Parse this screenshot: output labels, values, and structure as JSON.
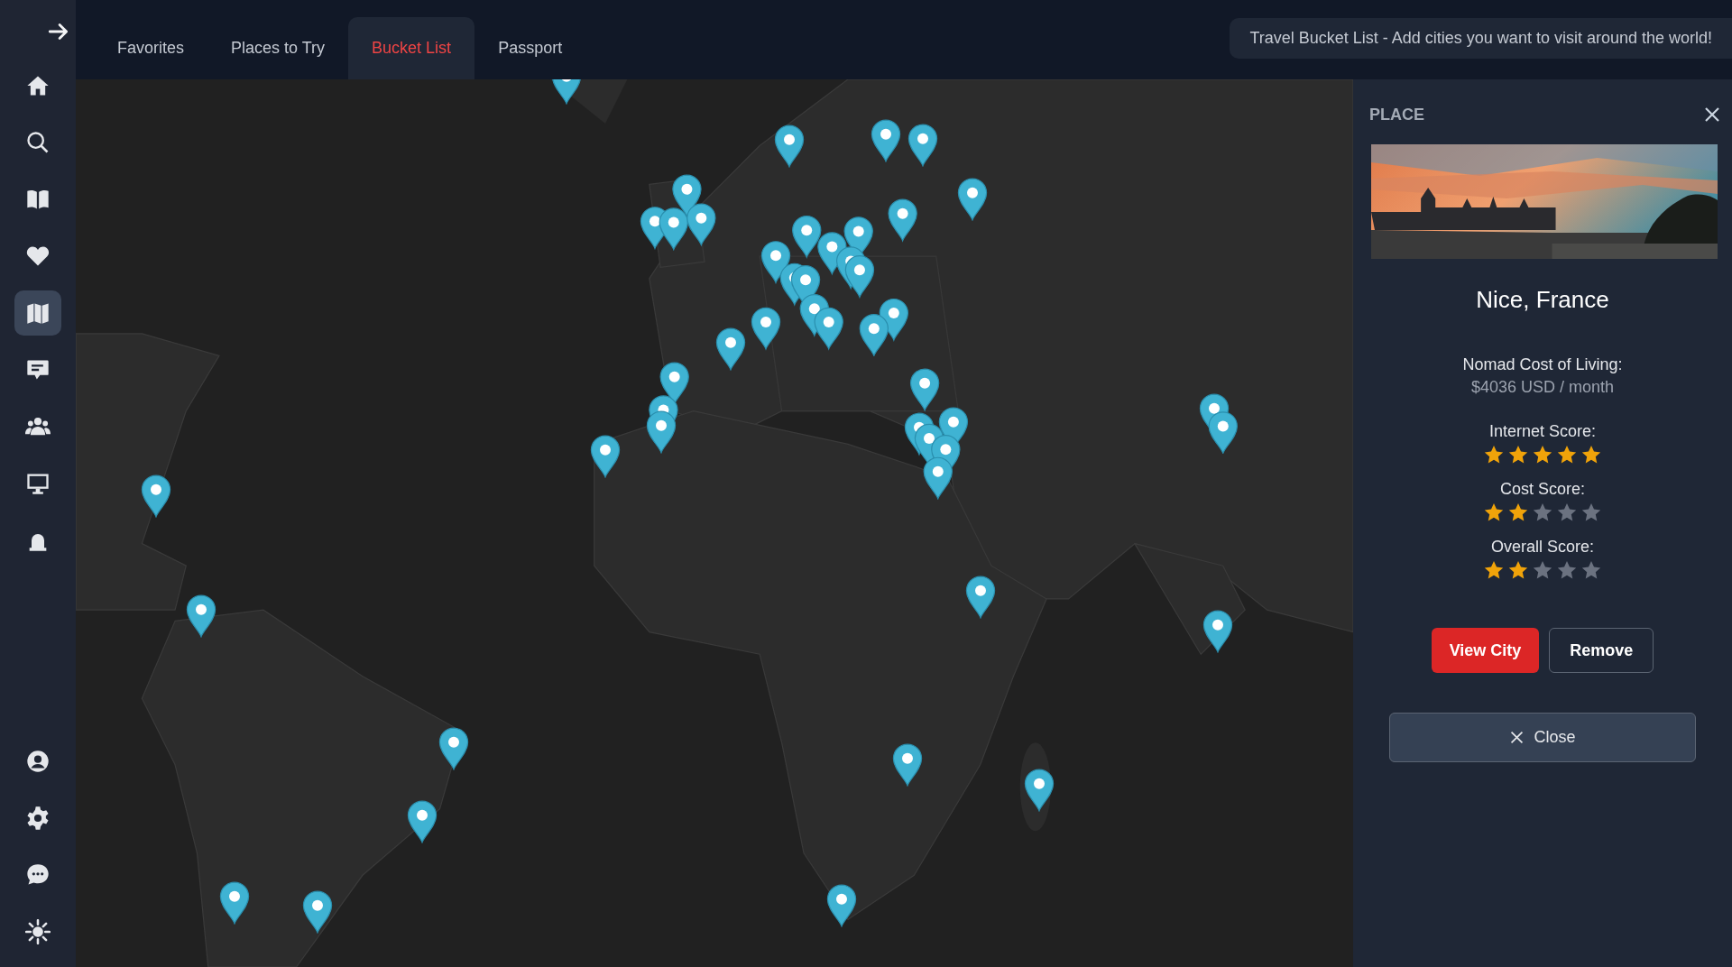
{
  "sidebar": {
    "items": [
      {
        "kind": "home",
        "selected": false
      },
      {
        "kind": "search",
        "selected": false
      },
      {
        "kind": "book",
        "selected": false
      },
      {
        "kind": "heart",
        "selected": false
      },
      {
        "kind": "map",
        "selected": true
      },
      {
        "kind": "message",
        "selected": false
      },
      {
        "kind": "group",
        "selected": false
      },
      {
        "kind": "monitor",
        "selected": false
      },
      {
        "kind": "stamp",
        "selected": false
      }
    ],
    "bottom_items": [
      {
        "kind": "user",
        "selected": false
      },
      {
        "kind": "gear",
        "selected": false
      },
      {
        "kind": "chat",
        "selected": false
      },
      {
        "kind": "sun",
        "selected": false
      }
    ]
  },
  "tabs": [
    {
      "label": "Favorites",
      "selected": false
    },
    {
      "label": "Places to Try",
      "selected": false
    },
    {
      "label": "Bucket List",
      "selected": true
    },
    {
      "label": "Passport",
      "selected": false
    }
  ],
  "banner": "Travel Bucket List - Add cities you want to visit around the world!",
  "place_panel": {
    "heading": "PLACE",
    "title": "Nice, France",
    "cost_label": "Nomad Cost of Living:",
    "cost_value": "$4036 USD / month",
    "scores": [
      {
        "label": "Internet Score:",
        "stars": 5
      },
      {
        "label": "Cost Score:",
        "stars": 2
      },
      {
        "label": "Overall Score:",
        "stars": 2
      }
    ],
    "buttons": [
      {
        "label": "View City",
        "kind": "primary"
      },
      {
        "label": "Remove",
        "kind": "outline"
      }
    ],
    "close_button": "Close"
  }
}
